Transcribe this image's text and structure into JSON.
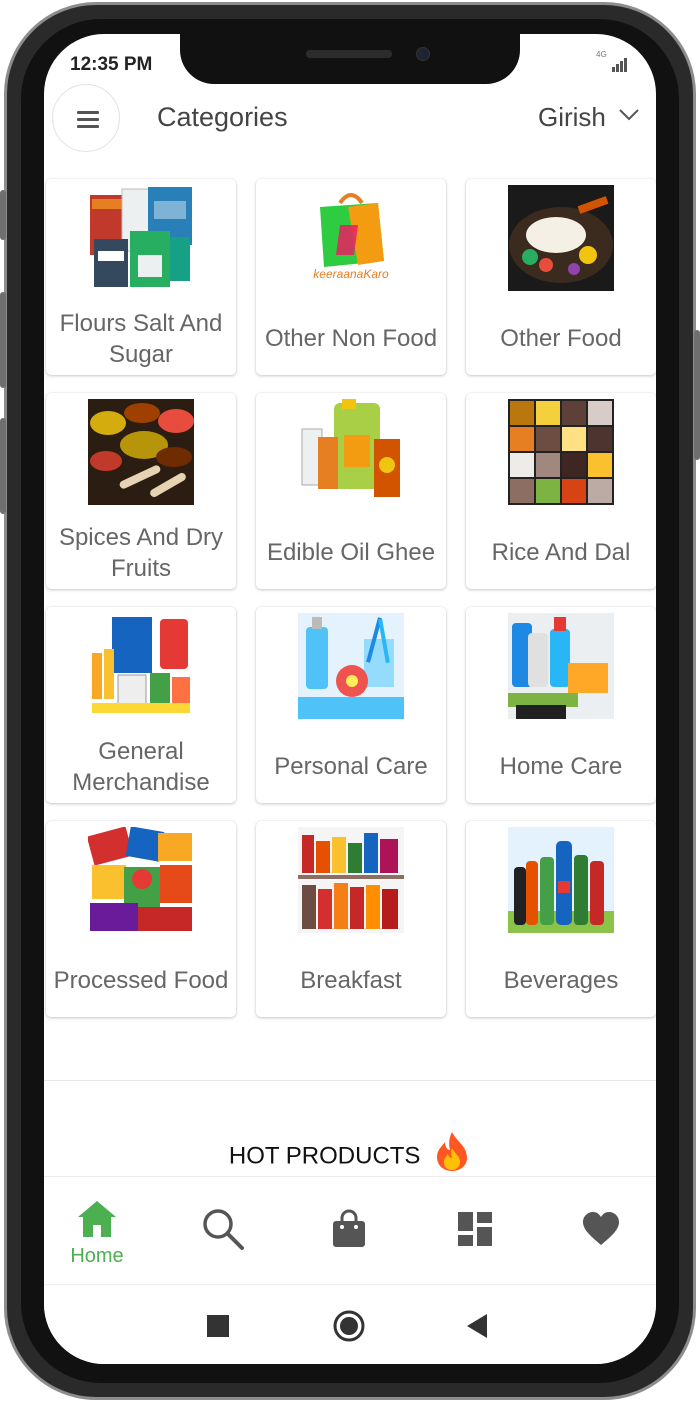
{
  "status_bar": {
    "time": "12:35 PM",
    "network": "4G"
  },
  "header": {
    "title": "Categories",
    "user_name": "Girish"
  },
  "categories": [
    {
      "name": "Flours Salt And Sugar",
      "image": "flour-salt-sugar-packages"
    },
    {
      "name": "Other Non Food",
      "image": "keeraana-karo-bag-logo",
      "logo_text": "keeraanaKaro"
    },
    {
      "name": "Other Food",
      "image": "sizzling-food-platter"
    },
    {
      "name": "Spices And Dry Fruits",
      "image": "spice-bowls"
    },
    {
      "name": "Edible Oil Ghee",
      "image": "fortune-oil-can"
    },
    {
      "name": "Rice And Dal",
      "image": "grain-pulse-grid"
    },
    {
      "name": "General Merchandise",
      "image": "stationery-supplies"
    },
    {
      "name": "Personal Care",
      "image": "toiletries-flower"
    },
    {
      "name": "Home Care",
      "image": "cleaning-supplies"
    },
    {
      "name": "Processed Food",
      "image": "snack-packets"
    },
    {
      "name": "Breakfast",
      "image": "pantry-shelf-jars"
    },
    {
      "name": "Beverages",
      "image": "soda-bottles"
    }
  ],
  "hot_products": {
    "label": "HOT PRODUCTS",
    "icon": "fire-icon"
  },
  "bottom_nav": [
    {
      "label": "Home",
      "icon": "home-icon",
      "active": true
    },
    {
      "label": "",
      "icon": "search-icon",
      "active": false
    },
    {
      "label": "",
      "icon": "shopping-bag-icon",
      "active": false
    },
    {
      "label": "",
      "icon": "categories-grid-icon",
      "active": false
    },
    {
      "label": "",
      "icon": "heart-icon",
      "active": false
    }
  ],
  "colors": {
    "accent": "#4caf50",
    "text": "#444444",
    "icon": "#555555"
  }
}
